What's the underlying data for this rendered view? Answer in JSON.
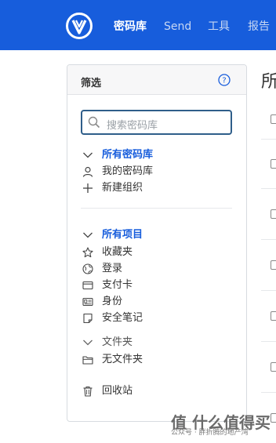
{
  "nav": {
    "items": [
      {
        "label": "密码库",
        "active": true
      },
      {
        "label": "Send",
        "active": false
      },
      {
        "label": "工具",
        "active": false
      },
      {
        "label": "报告",
        "active": false
      }
    ]
  },
  "filter": {
    "title": "筛选",
    "search_placeholder": "搜索密码库",
    "vaults_header": "所有密码库",
    "my_vault": "我的密码库",
    "new_org": "新建组织",
    "items_header": "所有项目",
    "favorites": "收藏夹",
    "login": "登录",
    "card": "支付卡",
    "identity": "身份",
    "secure_note": "安全笔记",
    "folders_header": "文件夹",
    "no_folder": "无文件夹",
    "trash": "回收站"
  },
  "main": {
    "title_partial": "所"
  },
  "watermark": {
    "logo_text": "值 什么值得买",
    "caption": "公众号 · 胖折腾的地产湾"
  },
  "colors": {
    "brand": "#175ddc",
    "search_border": "#2f5e8a"
  }
}
